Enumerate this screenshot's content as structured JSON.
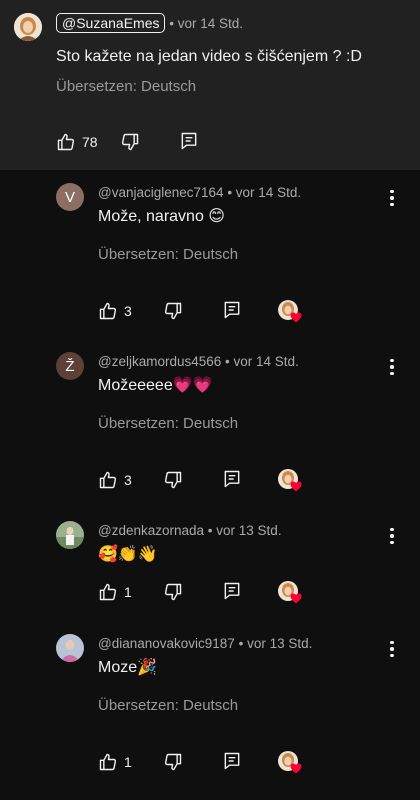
{
  "parent": {
    "author": "@SuzanaEmes",
    "time": "vor 14 Std.",
    "text": "Sto kažete na jedan video s čišćenjem ? :D",
    "translate": "Übersetzen: Deutsch",
    "likes": "78"
  },
  "replies": [
    {
      "author": "@vanjaciglenec7164",
      "time": "vor 14 Std.",
      "text": "Može, naravno 😊",
      "translate": "Übersetzen: Deutsch",
      "likes": "3",
      "avatar_letter": "V",
      "avatar_color": "#8d6e63"
    },
    {
      "author": "@zeljkamordus4566",
      "time": "vor 14 Std.",
      "text": "Možeeeee💗💗",
      "translate": "Übersetzen: Deutsch",
      "likes": "3",
      "avatar_letter": "Ž",
      "avatar_color": "#5d4037"
    },
    {
      "author": "@zdenkazornada",
      "time": "vor 13 Std.",
      "text": "🥰👏👋",
      "translate": "",
      "likes": "1"
    },
    {
      "author": "@diananovakovic9187",
      "time": "vor 13 Std.",
      "text": "Moze🎉",
      "translate": "Übersetzen: Deutsch",
      "likes": "1"
    }
  ],
  "icons": {
    "like": "thumb-up-icon",
    "dislike": "thumb-down-icon",
    "reply": "comment-reply-icon",
    "menu": "more-vert-icon",
    "creator_heart": "creator-heart-icon"
  },
  "colors": {
    "background": "#0f0f0f",
    "parent_background": "#212121",
    "heart": "#ff0033"
  }
}
